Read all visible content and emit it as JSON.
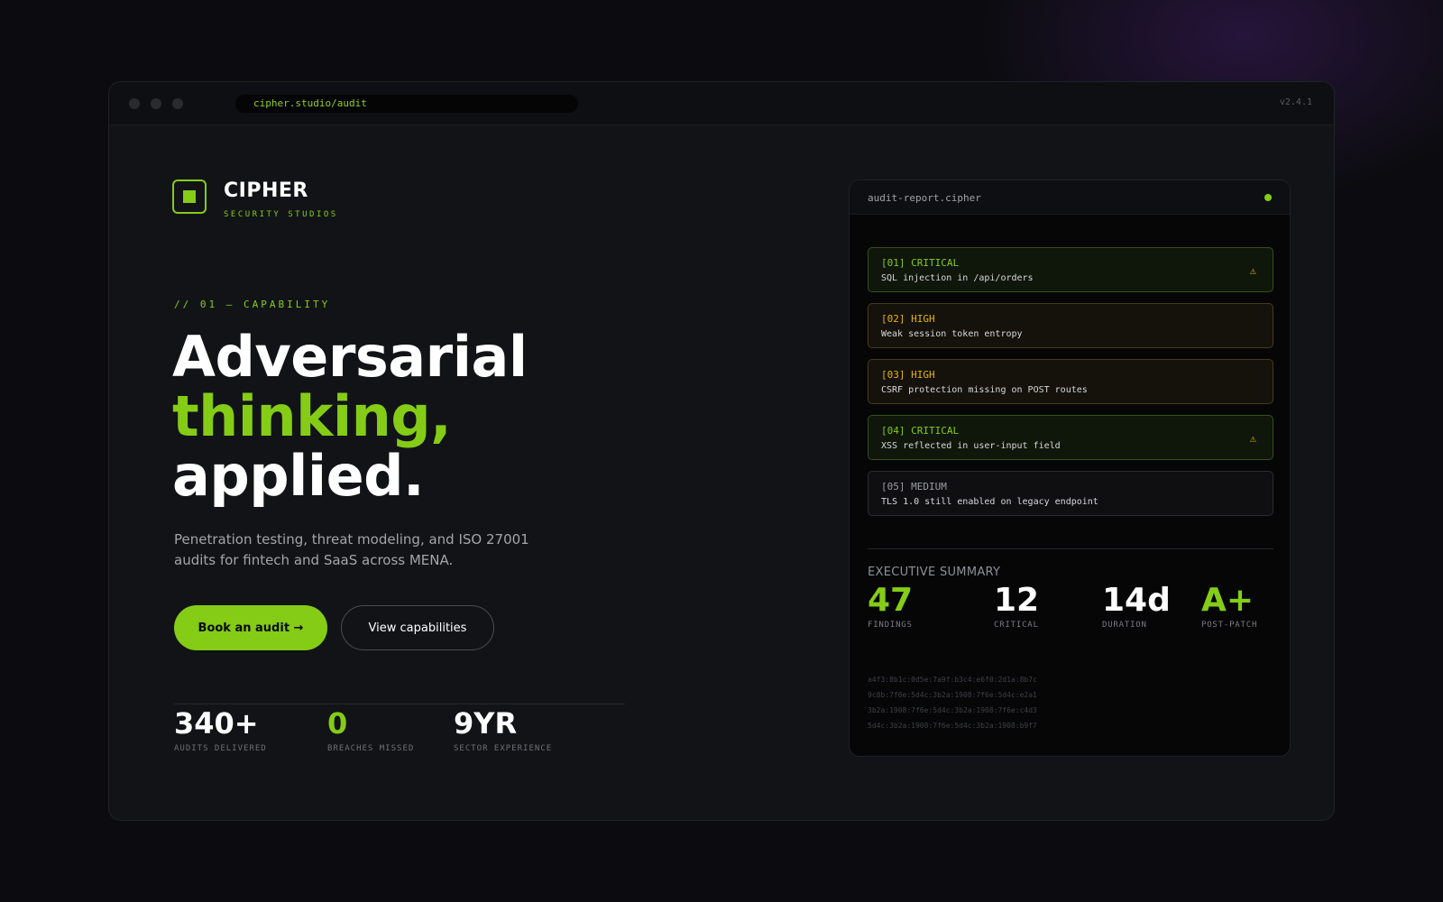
{
  "browser": {
    "url": "cipher.studio/audit",
    "version": "v2.4.1"
  },
  "brand": {
    "name": "CIPHER",
    "tagline": "SECURITY STUDIOS"
  },
  "hero": {
    "eyebrow": "// 01 — CAPABILITY",
    "headline_line1": "Adversarial",
    "headline_line2": "thinking,",
    "headline_line3": "applied.",
    "description": "Penetration testing, threat modeling, and ISO 27001 audits for fintech and SaaS across MENA.",
    "primary_cta": "Book an audit →",
    "secondary_cta": "View capabilities"
  },
  "stats": [
    {
      "value": "340+",
      "label": "AUDITS DELIVERED"
    },
    {
      "value": "0",
      "label": "BREACHES MISSED"
    },
    {
      "value": "9YR",
      "label": "SECTOR EXPERIENCE"
    }
  ],
  "report": {
    "filename": "audit-report.cipher",
    "findings": [
      {
        "severity": "[01] CRITICAL",
        "description": "SQL injection in /api/orders",
        "level": "critical",
        "icon": "warning-icon",
        "icon_glyph": "⚠"
      },
      {
        "severity": "[02] HIGH",
        "description": "Weak session token entropy",
        "level": "high"
      },
      {
        "severity": "[03] HIGH",
        "description": "CSRF protection missing on POST routes",
        "level": "high"
      },
      {
        "severity": "[04] CRITICAL",
        "description": "XSS reflected in user-input field",
        "level": "critical",
        "icon": "warning-icon",
        "icon_glyph": "⚠"
      },
      {
        "severity": "[05] MEDIUM",
        "description": "TLS 1.0 still enabled on legacy endpoint",
        "level": "medium"
      }
    ],
    "summary_label": "EXECUTIVE SUMMARY",
    "metrics": [
      {
        "value": "47",
        "label": "FINDINGS"
      },
      {
        "value": "12",
        "label": "CRITICAL"
      },
      {
        "value": "14d",
        "label": "DURATION"
      },
      {
        "value": "A+",
        "label": "POST-PATCH"
      }
    ],
    "hashes": [
      "a4f3:8b1c:0d5e:7a9f:b3c4:e6f0:2d1a:8b7c",
      "9c8b:7f6e:5d4c:3b2a:1908:7f6e:5d4c:e2a1",
      "3b2a:1908:7f6e:5d4c:3b2a:1908:7f6e:c4d3",
      "5d4c:3b2a:1908:7f6e:5d4c:3b2a:1908:b9f7"
    ]
  },
  "colors": {
    "accent": "#84cc16",
    "warning": "#eab308",
    "background": "#0c0c10",
    "surface": "#121317"
  }
}
